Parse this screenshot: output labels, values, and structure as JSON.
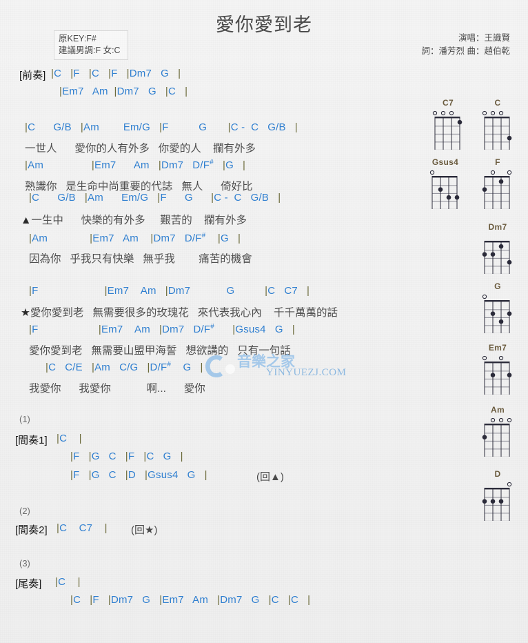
{
  "header": {
    "title": "愛你愛到老",
    "key_original": "原KEY:F#",
    "key_suggested": "建議男調:F 女:C",
    "singer": "演唱：王識賢",
    "writers": "詞：潘芳烈  曲：趙伯乾"
  },
  "watermark": {
    "text": "YINYUEZJ.COM"
  },
  "lines": [
    {
      "tag": "[前奏]",
      "chords": "|C   |F   |C   |F   |Dm7   G   |",
      "lyrics": ""
    },
    {
      "tag": "",
      "chords": "|Em7   Am  |Dm7   G   |C   |",
      "lyrics": ""
    },
    {
      "tag": "",
      "chords": "|C      G/B   |Am        Em/G   |F          G       |C -  C   G/B   |",
      "lyrics": "一世人      愛你的人有外多   你愛的人    攔有外多"
    },
    {
      "tag": "",
      "chords": "|Am                |Em7      Am   |Dm7   D/F#   |G   |",
      "lyrics": "熟識你   是生命中尚重要的代誌   無人      倚好比"
    },
    {
      "tag": "",
      "chords": "|C      G/B   |Am      Em/G   |F      G      |C -  C   G/B   |",
      "lyrics": "▲一生中      快樂的有外多     艱苦的    攔有外多"
    },
    {
      "tag": "",
      "chords": "|Am              |Em7   Am    |Dm7   D/F#    |G   |",
      "lyrics": "因為你   乎我只有快樂   無乎我        痛苦的機會"
    },
    {
      "tag": "",
      "chords": "|F                      |Em7    Am   |Dm7            G          |C   C7   |",
      "lyrics": "★愛你愛到老   無需要很多的玫瑰花   來代表我心內    千千萬萬的話"
    },
    {
      "tag": "",
      "chords": "|F                    |Em7    Am   |Dm7   D/F#      |Gsus4   G   |",
      "lyrics": "愛你愛到老   無需要山盟甲海誓   想欲講的   只有一句話"
    },
    {
      "tag": "",
      "chords": "|C   C/E   |Am   C/G   |D/F#    G   |",
      "lyrics": "我愛你      我愛你            啊...      愛你"
    }
  ],
  "sections": [
    {
      "number": "(1)",
      "tag": "[間奏1]",
      "rows": [
        "|C    |",
        "|F   |G   C   |F   |C   G   |",
        "|F   |G   C   |D   |Gsus4   G   |"
      ],
      "repeat": "(回▲)"
    },
    {
      "number": "(2)",
      "tag": "[間奏2]",
      "rows": [
        "|C    C7    |"
      ],
      "repeat": "(回★)"
    },
    {
      "number": "(3)",
      "tag": "[尾奏]",
      "rows": [
        "|C    |",
        "|C   |F   |Dm7   G   |Em7   Am   |Dm7   G   |C   |C   |"
      ],
      "repeat": ""
    }
  ],
  "chord_diagrams": [
    {
      "name": "C7",
      "open": [
        1,
        2,
        3
      ],
      "dots": [
        {
          "string": 4,
          "fret": 1
        }
      ]
    },
    {
      "name": "C",
      "open": [
        1,
        2,
        3
      ],
      "dots": [
        {
          "string": 4,
          "fret": 3
        }
      ]
    },
    {
      "name": "Gsus4",
      "open": [
        1
      ],
      "dots": [
        {
          "string": 2,
          "fret": 2
        },
        {
          "string": 3,
          "fret": 3
        },
        {
          "string": 4,
          "fret": 3
        }
      ]
    },
    {
      "name": "F",
      "open": [
        2,
        4
      ],
      "dots": [
        {
          "string": 1,
          "fret": 2
        },
        {
          "string": 3,
          "fret": 1
        }
      ]
    },
    {
      "name": "Dm7",
      "open": [],
      "dots": [
        {
          "string": 1,
          "fret": 2
        },
        {
          "string": 2,
          "fret": 2
        },
        {
          "string": 3,
          "fret": 1
        },
        {
          "string": 4,
          "fret": 3
        }
      ]
    },
    {
      "name": "G",
      "open": [
        1
      ],
      "dots": [
        {
          "string": 2,
          "fret": 2
        },
        {
          "string": 3,
          "fret": 3
        },
        {
          "string": 4,
          "fret": 2
        }
      ]
    },
    {
      "name": "Em7",
      "open": [
        1,
        3
      ],
      "dots": [
        {
          "string": 2,
          "fret": 2
        },
        {
          "string": 4,
          "fret": 2
        }
      ]
    },
    {
      "name": "Am",
      "open": [
        2,
        3,
        4
      ],
      "dots": [
        {
          "string": 1,
          "fret": 2
        }
      ]
    },
    {
      "name": "D",
      "open": [
        4
      ],
      "dots": [
        {
          "string": 1,
          "fret": 2
        },
        {
          "string": 2,
          "fret": 2
        },
        {
          "string": 3,
          "fret": 2
        }
      ]
    }
  ],
  "colors": {
    "chord": "#2f7fd0",
    "bar": "#6b6a3a",
    "lyric": "#4f4f4f",
    "diagram_label": "#6a5b3e",
    "watermark": "#6fa8dc"
  }
}
